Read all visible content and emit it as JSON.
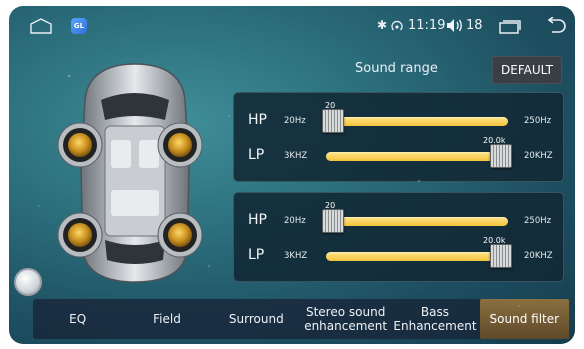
{
  "statusbar": {
    "app_badge": "GL",
    "time": "11:19",
    "volume": "18"
  },
  "sound_range": {
    "title": "Sound range",
    "default_label": "DEFAULT"
  },
  "panels": [
    {
      "hp": {
        "label": "HP",
        "min": "20Hz",
        "max": "250Hz",
        "value": "20",
        "position": 0.0
      },
      "lp": {
        "label": "LP",
        "min": "3KHZ",
        "max": "20KHZ",
        "value": "20.0k",
        "position": 1.0
      }
    },
    {
      "hp": {
        "label": "HP",
        "min": "20Hz",
        "max": "250Hz",
        "value": "20",
        "position": 0.0
      },
      "lp": {
        "label": "LP",
        "min": "3KHZ",
        "max": "20KHZ",
        "value": "20.0k",
        "position": 1.0
      }
    }
  ],
  "tabs": [
    {
      "label": "EQ",
      "active": false
    },
    {
      "label": "Field",
      "active": false
    },
    {
      "label": "Surround",
      "active": false
    },
    {
      "label": "Stereo sound enhancement",
      "active": false
    },
    {
      "label": "Bass Enhancement",
      "active": false
    },
    {
      "label": "Sound filter",
      "active": true
    }
  ],
  "colors": {
    "accent": "#f3c33b",
    "active_tab": "#8a6f3f",
    "background": "#2c6f7c"
  }
}
